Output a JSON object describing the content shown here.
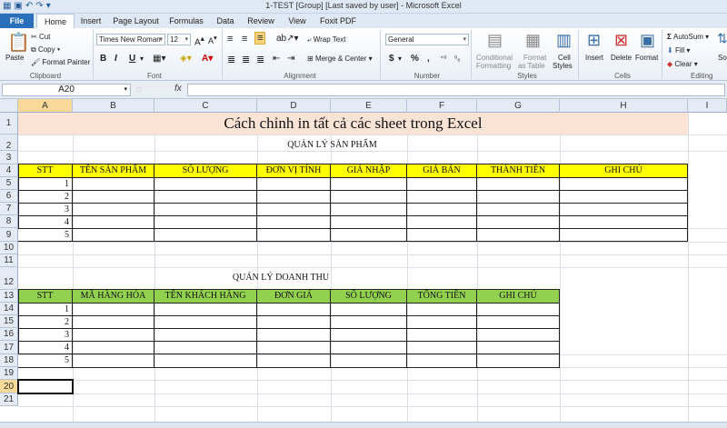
{
  "window": {
    "title": "1-TEST  [Group] [Last saved by user] - Microsoft Excel"
  },
  "tabs": [
    "File",
    "Home",
    "Insert",
    "Page Layout",
    "Formulas",
    "Data",
    "Review",
    "View",
    "Foxit PDF"
  ],
  "ribbon": {
    "clipboard": {
      "paste": "Paste",
      "cut": "Cut",
      "copy": "Copy",
      "format_painter": "Format Painter",
      "label": "Clipboard"
    },
    "font": {
      "name": "Times New Roman",
      "size": "12",
      "bold": "B",
      "italic": "I",
      "underline": "U",
      "label": "Font"
    },
    "alignment": {
      "wrap_text": "Wrap Text",
      "merge_center": "Merge & Center",
      "label": "Alignment"
    },
    "number": {
      "format": "General",
      "currency": "$",
      "percent": "%",
      "comma": ",",
      "label": "Number"
    },
    "styles": {
      "conditional": "Conditional",
      "conditional2": "Formatting",
      "format_as": "Format",
      "format_as2": "as Table",
      "cell": "Cell",
      "cell2": "Styles",
      "label": "Styles"
    },
    "cells": {
      "insert": "Insert",
      "delete": "Delete",
      "format": "Format",
      "label": "Cells"
    },
    "editing": {
      "autosum": "AutoSum",
      "fill": "Fill",
      "clear": "Clear",
      "sort": "So",
      "label": "Editing"
    }
  },
  "formula_bar": {
    "name_box": "A20",
    "fx": "fx",
    "value": ""
  },
  "columns": [
    "A",
    "B",
    "C",
    "D",
    "E",
    "F",
    "G",
    "H",
    "I"
  ],
  "rows": [
    "1",
    "2",
    "3",
    "4",
    "5",
    "6",
    "7",
    "8",
    "9",
    "10",
    "11",
    "12",
    "13",
    "14",
    "15",
    "16",
    "17",
    "18",
    "19",
    "20",
    "21"
  ],
  "sheet": {
    "title": "Cách chỉnh in tất cả các sheet trong Excel",
    "table1": {
      "caption": "QUẢN LÝ SẢN PHẨM",
      "headers": [
        "STT",
        "TÊN SẢN PHẨM",
        "SỐ LƯỢNG",
        "ĐƠN VỊ TÍNH",
        "GIÁ NHẬP",
        "GIÁ BÁN",
        "THÀNH TIỀN",
        "GHI CHÚ"
      ],
      "rows": [
        "1",
        "2",
        "3",
        "4",
        "5"
      ]
    },
    "table2": {
      "caption": "QUẢN LÝ DOANH THU",
      "headers": [
        "STT",
        "MÃ HÀNG HÓA",
        "TÊN KHÁCH HÀNG",
        "ĐƠN GIÁ",
        "SỐ LƯỢNG",
        "TỔNG TIỀN",
        "GHI CHÚ"
      ],
      "rows": [
        "1",
        "2",
        "3",
        "4",
        "5"
      ]
    }
  },
  "colors": {
    "header_yellow": "#ffff00",
    "header_green": "#92d050",
    "title_band": "#fbe4d5",
    "file_tab": "#2a6fba"
  }
}
